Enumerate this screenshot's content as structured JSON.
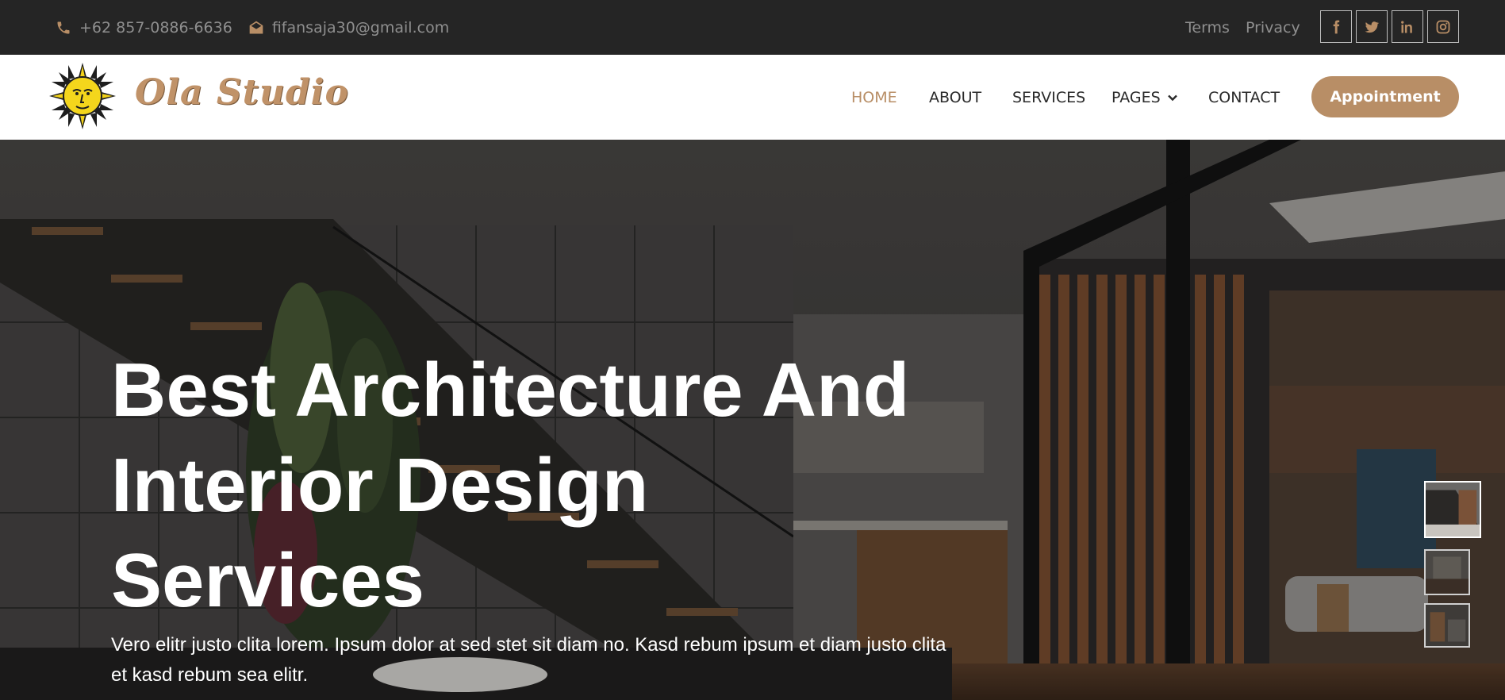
{
  "topbar": {
    "phone": "+62 857-0886-6636",
    "email": "fifansaja30@gmail.com",
    "links": [
      "Terms",
      "Privacy"
    ],
    "social": [
      "facebook-icon",
      "twitter-icon",
      "linkedin-icon",
      "instagram-icon"
    ]
  },
  "navbar": {
    "brand": "Ola Studio",
    "items": [
      {
        "label": "HOME",
        "active": true
      },
      {
        "label": "ABOUT"
      },
      {
        "label": "SERVICES"
      },
      {
        "label": "PAGES",
        "dropdown": true
      },
      {
        "label": "CONTACT"
      }
    ],
    "cta": "Appointment"
  },
  "hero": {
    "title_lines": [
      "Best Architecture And",
      "Interior Design",
      "Services"
    ],
    "description": "Vero elitr justo clita lorem. Ipsum dolor at sed stet sit diam no. Kasd rebum ipsum et diam justo clita et kasd rebum sea elitr."
  },
  "colors": {
    "accent": "#b88e66",
    "topbar_bg": "#252525",
    "topbar_text": "#8f8f8f",
    "nav_text": "#2a2a2a"
  }
}
